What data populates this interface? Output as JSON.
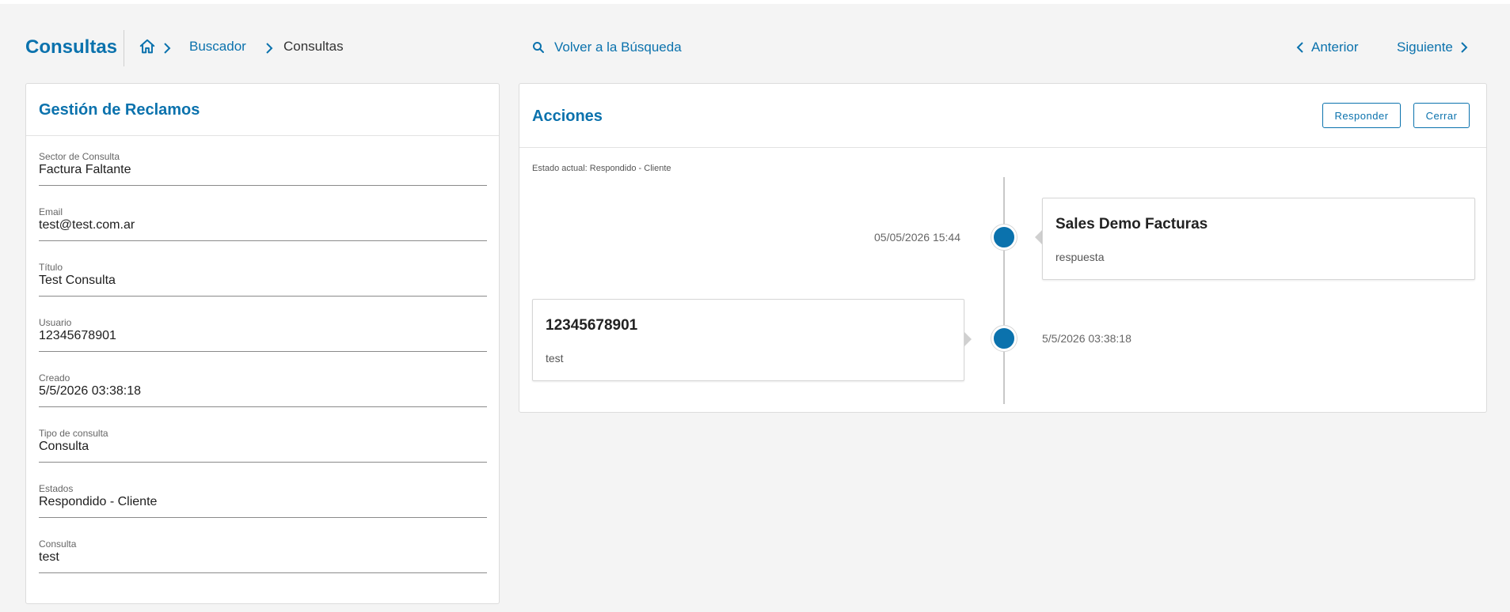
{
  "header": {
    "title": "Consultas",
    "breadcrumb": [
      "Buscador",
      "Consultas"
    ],
    "back_search": "Volver a la Búsqueda",
    "prev": "Anterior",
    "next": "Siguiente"
  },
  "left_card": {
    "title": "Gestión de Reclamos",
    "fields": [
      {
        "label": "Sector de Consulta",
        "value": "Factura Faltante"
      },
      {
        "label": "Email",
        "value": "test@test.com.ar"
      },
      {
        "label": "Título",
        "value": "Test Consulta"
      },
      {
        "label": "Usuario",
        "value": "12345678901"
      },
      {
        "label": "Creado",
        "value": "5/5/2026 03:38:18"
      },
      {
        "label": "Tipo de consulta",
        "value": "Consulta"
      },
      {
        "label": "Estados",
        "value": "Respondido - Cliente"
      },
      {
        "label": "Consulta",
        "value": "test"
      }
    ]
  },
  "right_card": {
    "title": "Acciones",
    "buttons": {
      "respond": "Responder",
      "close": "Cerrar"
    },
    "estado": "Estado actual: Respondido - Cliente",
    "timeline": [
      {
        "date": "05/05/2026 15:44",
        "title": "Sales Demo Facturas",
        "body": "respuesta"
      },
      {
        "date": "5/5/2026 03:38:18",
        "title": "12345678901",
        "body": "test"
      }
    ]
  },
  "colors": {
    "accent": "#0b72ad",
    "background": "#f4f4f4"
  },
  "icons": [
    "home-icon",
    "chevron-right-icon",
    "search-icon",
    "chevron-left-icon"
  ]
}
